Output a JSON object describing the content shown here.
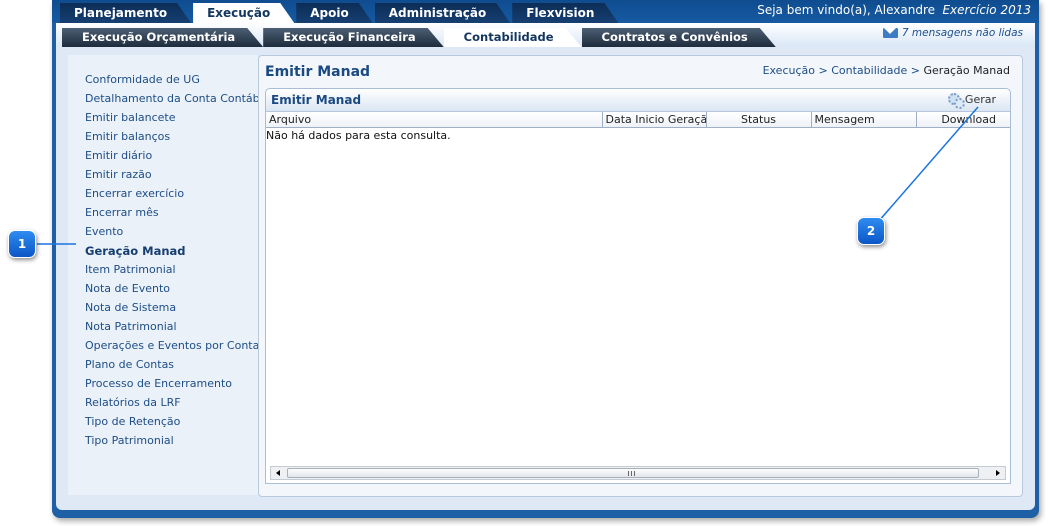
{
  "topbar": {
    "tabs": [
      {
        "label": "Planejamento",
        "active": false
      },
      {
        "label": "Execução",
        "active": true
      },
      {
        "label": "Apoio",
        "active": false
      },
      {
        "label": "Administração",
        "active": false
      },
      {
        "label": "Flexvision",
        "active": false
      }
    ],
    "welcome": "Seja bem vindo(a), Alexandre",
    "exercise": "Exercício 2013"
  },
  "subbar": {
    "tabs": [
      {
        "label": "Execução Orçamentária",
        "active": false
      },
      {
        "label": "Execução Financeira",
        "active": false
      },
      {
        "label": "Contabilidade",
        "active": true
      },
      {
        "label": "Contratos e Convênios",
        "active": false
      }
    ],
    "messages": "7 mensagens não lidas"
  },
  "sidebar": {
    "items": [
      "Conformidade de UG",
      "Detalhamento da Conta Contábil",
      "Emitir balancete",
      "Emitir balanços",
      "Emitir diário",
      "Emitir razão",
      "Encerrar exercício",
      "Encerrar mês",
      "Evento",
      "Geração Manad",
      "Item Patrimonial",
      "Nota de Evento",
      "Nota de Sistema",
      "Nota Patrimonial",
      "Operações e Eventos por Conta",
      "Plano de Contas",
      "Processo de Encerramento",
      "Relatórios da LRF",
      "Tipo de Retenção",
      "Tipo Patrimonial"
    ],
    "active_index": 9
  },
  "main": {
    "page_title": "Emitir Manad",
    "breadcrumb": [
      "Execução",
      "Contabilidade",
      "Geração Manad"
    ],
    "panel_title": "Emitir Manad",
    "generate_label": "Gerar",
    "columns": [
      "Arquivo",
      "Data Inicio Geração",
      "Status",
      "Mensagem",
      "Download"
    ],
    "empty_message": "Não há dados para esta consulta."
  },
  "callouts": [
    "1",
    "2"
  ],
  "colors": {
    "frame": "#1f5fa6",
    "callout": "#1b73e0",
    "link": "#1e4d86"
  }
}
